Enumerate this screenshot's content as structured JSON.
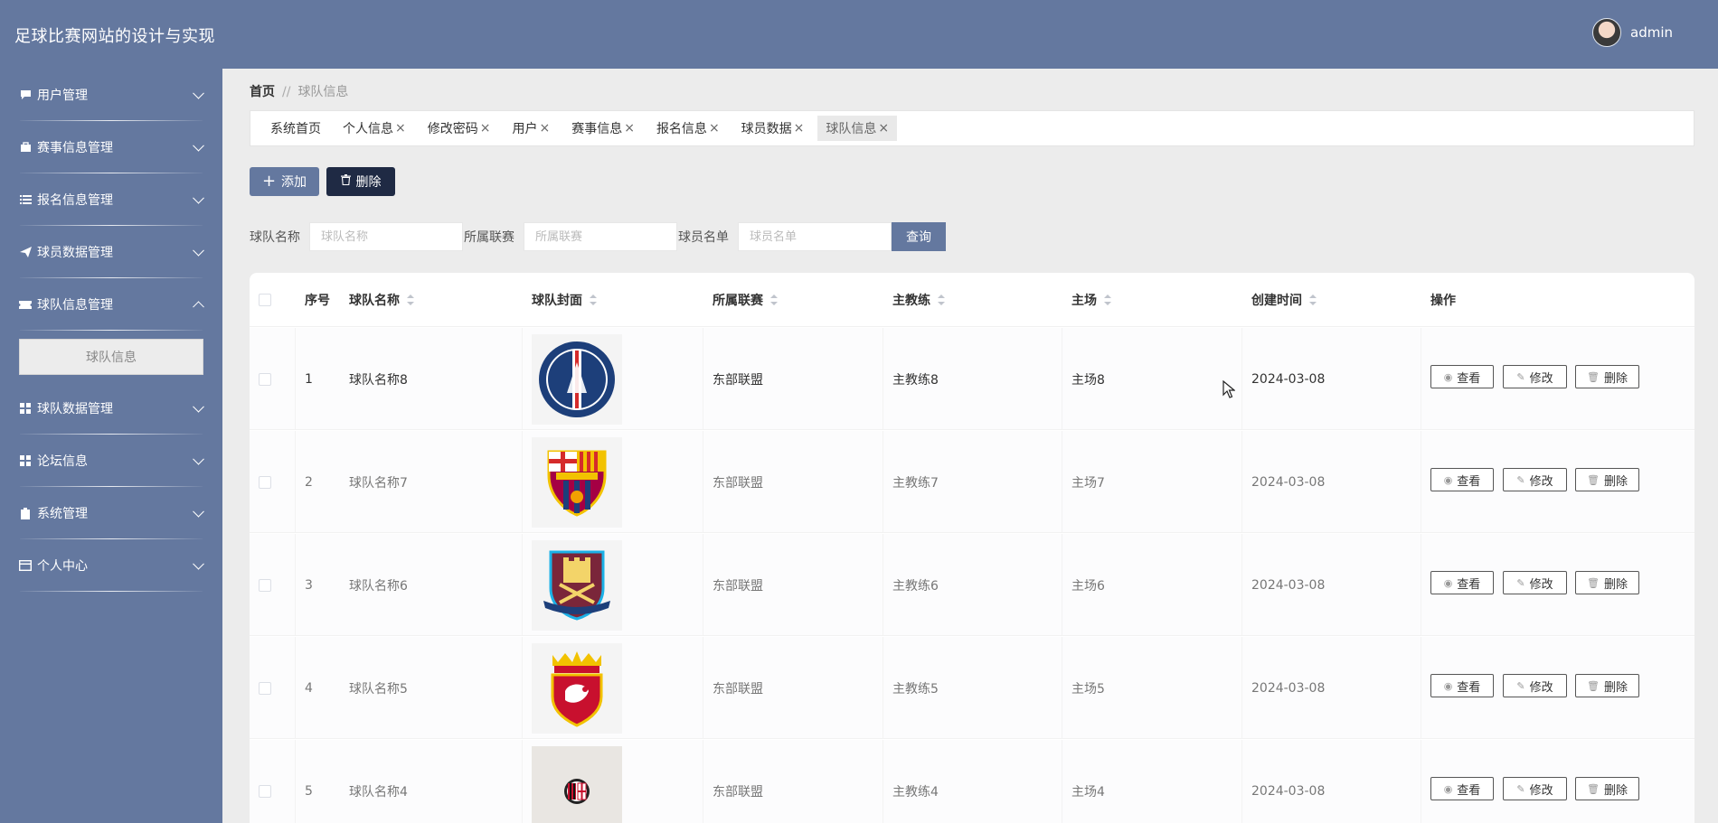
{
  "app": {
    "title": "足球比赛网站的设计与实现",
    "user": "admin"
  },
  "sidebar": {
    "items": [
      {
        "label": "用户管理",
        "icon": "comment-icon"
      },
      {
        "label": "赛事信息管理",
        "icon": "briefcase-icon"
      },
      {
        "label": "报名信息管理",
        "icon": "list-icon"
      },
      {
        "label": "球员数据管理",
        "icon": "send-icon"
      },
      {
        "label": "球队信息管理",
        "icon": "ticket-icon",
        "expanded": true
      },
      {
        "label": "球队数据管理",
        "icon": "grid-icon"
      },
      {
        "label": "论坛信息",
        "icon": "grid-icon"
      },
      {
        "label": "系统管理",
        "icon": "clipboard-icon"
      },
      {
        "label": "个人中心",
        "icon": "card-icon"
      }
    ],
    "active_sub": "球队信息"
  },
  "breadcrumb": {
    "home": "首页",
    "separator": "//",
    "current": "球队信息"
  },
  "tabs": [
    {
      "label": "系统首页",
      "closable": false
    },
    {
      "label": "个人信息",
      "closable": true
    },
    {
      "label": "修改密码",
      "closable": true
    },
    {
      "label": "用户",
      "closable": true
    },
    {
      "label": "赛事信息",
      "closable": true
    },
    {
      "label": "报名信息",
      "closable": true
    },
    {
      "label": "球员数据",
      "closable": true
    },
    {
      "label": "球队信息",
      "closable": true,
      "active": true
    }
  ],
  "toolbar": {
    "add_label": "添加",
    "delete_label": "删除"
  },
  "search": {
    "team_name_label": "球队名称",
    "team_name_placeholder": "球队名称",
    "team_name_value": "",
    "league_label": "所属联赛",
    "league_placeholder": "所属联赛",
    "league_value": "",
    "roster_label": "球员名单",
    "roster_placeholder": "球员名单",
    "roster_value": "",
    "query_label": "查询"
  },
  "table": {
    "headers": [
      "序号",
      "球队名称",
      "球队封面",
      "所属联赛",
      "主教练",
      "主场",
      "创建时间",
      "操作"
    ],
    "rows": [
      {
        "no": "1",
        "name": "球队名称8",
        "cover": "psg-crest",
        "league": "东部联盟",
        "coach": "主教练8",
        "stadium": "主场8",
        "created": "2024-03-08"
      },
      {
        "no": "2",
        "name": "球队名称7",
        "cover": "barcelona-crest",
        "league": "东部联盟",
        "coach": "主教练7",
        "stadium": "主场7",
        "created": "2024-03-08"
      },
      {
        "no": "3",
        "name": "球队名称6",
        "cover": "westham-crest",
        "league": "东部联盟",
        "coach": "主教练6",
        "stadium": "主场6",
        "created": "2024-03-08"
      },
      {
        "no": "4",
        "name": "球队名称5",
        "cover": "shanghai-crest",
        "league": "东部联盟",
        "coach": "主教练5",
        "stadium": "主场5",
        "created": "2024-03-08"
      },
      {
        "no": "5",
        "name": "球队名称4",
        "cover": "milan-crest",
        "league": "东部联盟",
        "coach": "主教练4",
        "stadium": "主场4",
        "created": "2024-03-08"
      }
    ],
    "actions": {
      "view": "查看",
      "edit": "修改",
      "delete": "删除"
    }
  },
  "colors": {
    "primary": "#64789f",
    "dark_button": "#1f2a44",
    "background": "#ececec"
  }
}
